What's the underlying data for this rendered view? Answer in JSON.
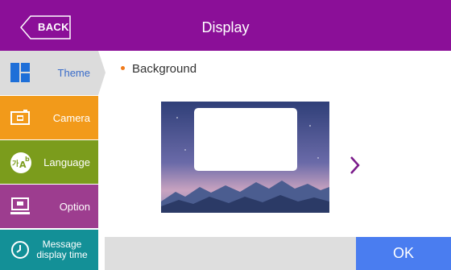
{
  "header": {
    "title": "Display",
    "back_label": "BACK",
    "color": "#8b0f98"
  },
  "sidebar": {
    "items": [
      {
        "label": "Theme",
        "icon": "theme-grid-icon",
        "color": "#dcdcdc",
        "selected": true
      },
      {
        "label": "Camera",
        "icon": "camera-icon",
        "color": "#f29a1a",
        "selected": false
      },
      {
        "label": "Language",
        "icon": "language-icon",
        "color": "#7b9c1c",
        "selected": false
      },
      {
        "label": "Option",
        "icon": "monitor-icon",
        "color": "#9d3d8f",
        "selected": false
      },
      {
        "label": "Message display time",
        "icon": "clock-icon",
        "color": "#139097",
        "selected": false
      }
    ]
  },
  "main": {
    "section_label": "Background",
    "preview_icon": "mountain-night-sky-image",
    "next_icon": "chevron-right-icon"
  },
  "footer": {
    "ok_label": "OK",
    "ok_color": "#4a7df0"
  }
}
